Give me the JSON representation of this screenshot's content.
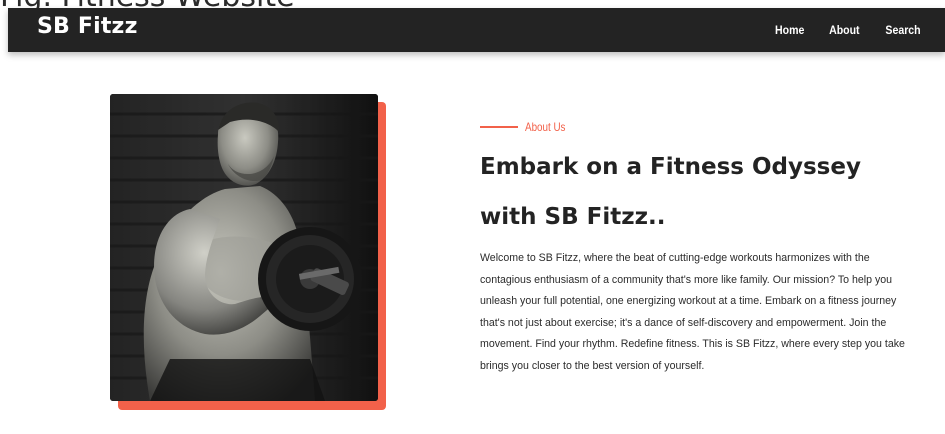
{
  "top_caption": "Fig. Fitness Website",
  "navbar": {
    "brand": "SB Fitzz",
    "links": [
      {
        "label": "Home"
      },
      {
        "label": "About"
      },
      {
        "label": "Search"
      }
    ]
  },
  "hero_image": {
    "alt": "photo of a muscular man lifting a dumbbell"
  },
  "about": {
    "eyebrow": "About Us",
    "headline": "Embark on a Fitness Odyssey with SB Fitzz..",
    "body": "Welcome to SB Fitzz, where the beat of cutting-edge workouts harmonizes with the contagious enthusiasm of a community that's more like family. Our mission? To help you unleash your full potential, one energizing workout at a time. Embark on a fitness journey that's not just about exercise; it's a dance of self-discovery and empowerment. Join the movement. Find your rhythm. Redefine fitness. This is SB Fitzz, where every step you take brings you closer to the best version of yourself."
  },
  "colors": {
    "accent": "#f2614a",
    "navbar_bg": "#232323",
    "heading": "#232323"
  }
}
